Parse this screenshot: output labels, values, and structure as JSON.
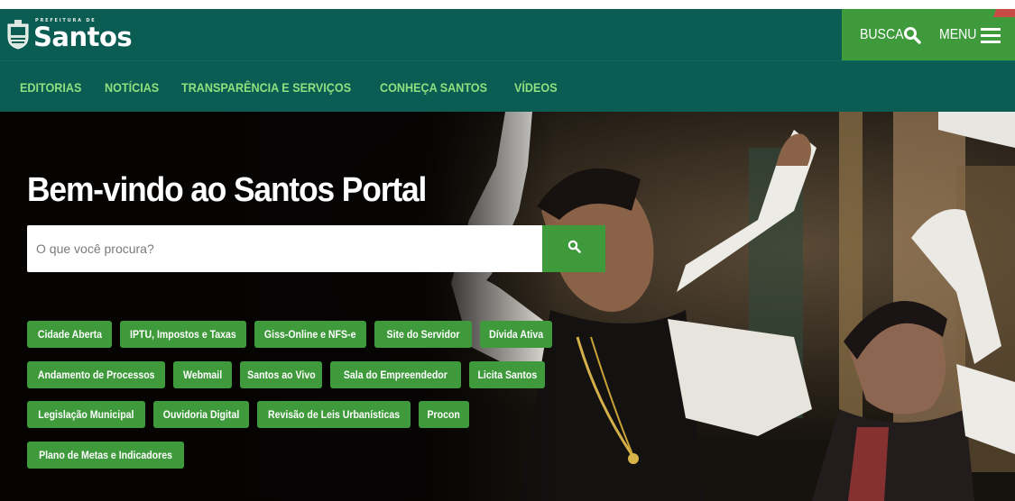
{
  "header": {
    "logo": {
      "small": "PREFEITURA DE",
      "big": "Santos"
    },
    "busca_label": "BUSCA",
    "menu_label": "MENU",
    "colors": {
      "primary": "#0b5c52",
      "accent": "#3e9a3b",
      "nav_text": "#8fe07f"
    }
  },
  "nav": {
    "items": [
      {
        "label": "EDITORIAS"
      },
      {
        "label": "NOTÍCIAS"
      },
      {
        "label": "TRANSPARÊNCIA E SERVIÇOS"
      },
      {
        "label": "CONHEÇA SANTOS"
      },
      {
        "label": "VÍDEOS"
      }
    ]
  },
  "hero": {
    "title": "Bem-vindo ao Santos Portal",
    "search_placeholder": "O que você procura?",
    "search_button_icon": "search-icon",
    "quick_links": [
      [
        "Cidade Aberta",
        "IPTU, Impostos e Taxas",
        "Giss-Online e NFS-e",
        "Site do Servidor",
        "Dívida Ativa"
      ],
      [
        "Andamento de Processos",
        "Webmail",
        "Santos ao Vivo",
        "Sala do Empreendedor",
        "Licita Santos"
      ],
      [
        "Legislação Municipal",
        "Ouvidoria Digital",
        "Revisão de Leis Urbanísticas",
        "Procon"
      ],
      [
        "Plano de Metas e Indicadores"
      ]
    ]
  }
}
